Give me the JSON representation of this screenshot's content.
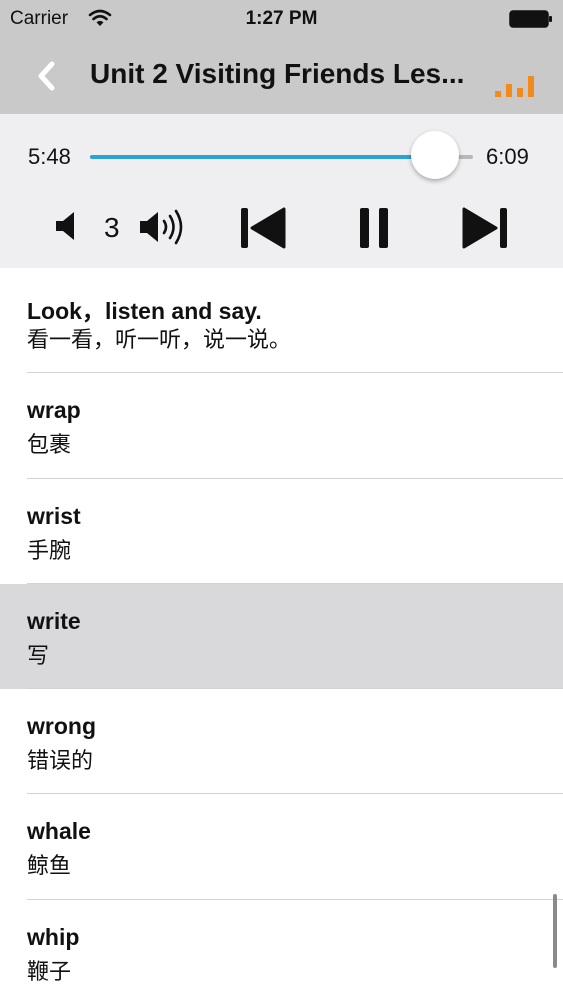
{
  "status_bar": {
    "carrier": "Carrier",
    "time": "1:27 PM"
  },
  "nav": {
    "title": "Unit 2 Visiting Friends Les...",
    "back_icon": "chevron-left-icon",
    "audio_icon": "audio-bars-icon",
    "accent_color": "#f28a1c"
  },
  "player": {
    "elapsed": "5:48",
    "total": "6:09",
    "progress": 0.9,
    "volume_level": "3",
    "progress_color": "#2aa3d9"
  },
  "words": [
    {
      "english": "Look，listen and say.",
      "chinese": "看一看，听一听，说一说。",
      "selected": false
    },
    {
      "english": "wrap",
      "chinese": "包裹",
      "selected": false
    },
    {
      "english": "wrist",
      "chinese": "手腕",
      "selected": false
    },
    {
      "english": "write",
      "chinese": "写",
      "selected": true
    },
    {
      "english": "wrong",
      "chinese": "错误的",
      "selected": false
    },
    {
      "english": "whale",
      "chinese": "鲸鱼",
      "selected": false
    },
    {
      "english": "whip",
      "chinese": "鞭子",
      "selected": false
    }
  ]
}
